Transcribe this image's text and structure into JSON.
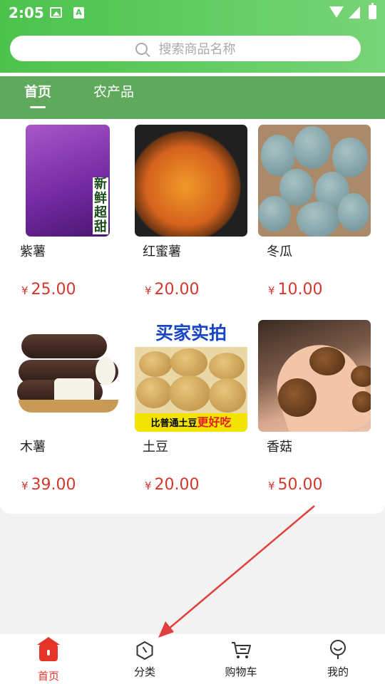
{
  "status_bar": {
    "time": "2:05"
  },
  "search": {
    "placeholder": "搜索商品名称"
  },
  "tabs": [
    {
      "label": "首页",
      "active": true
    },
    {
      "label": "农产品",
      "active": false
    }
  ],
  "products": [
    {
      "name": "紫薯",
      "currency": "¥",
      "price": "25.00",
      "image": "purple-sweet-potato",
      "image_text": "新鲜超甜"
    },
    {
      "name": "红蜜薯",
      "currency": "¥",
      "price": "20.00",
      "image": "roasted-sweet-potato"
    },
    {
      "name": "冬瓜",
      "currency": "¥",
      "price": "10.00",
      "image": "winter-melons"
    },
    {
      "name": "木薯",
      "currency": "¥",
      "price": "39.00",
      "image": "cassava"
    },
    {
      "name": "土豆",
      "currency": "¥",
      "price": "20.00",
      "image": "potatoes",
      "image_text_top": "买家实拍",
      "image_text_bottom": "比普通土豆",
      "image_text_bottom_em": "更好吃"
    },
    {
      "name": "香菇",
      "currency": "¥",
      "price": "50.00",
      "image": "shiitake-mushrooms"
    }
  ],
  "bottom_nav": [
    {
      "label": "首页",
      "icon": "home-icon",
      "active": true
    },
    {
      "label": "分类",
      "icon": "category-icon",
      "active": false
    },
    {
      "label": "购物车",
      "icon": "cart-icon",
      "active": false
    },
    {
      "label": "我的",
      "icon": "profile-icon",
      "active": false
    }
  ],
  "colors": {
    "header_green": "#4cc24c",
    "tab_bar_green": "#5fa95c",
    "price_red": "#d4372c",
    "active_red": "#e5332a",
    "annotation_arrow": "#e0403c"
  }
}
